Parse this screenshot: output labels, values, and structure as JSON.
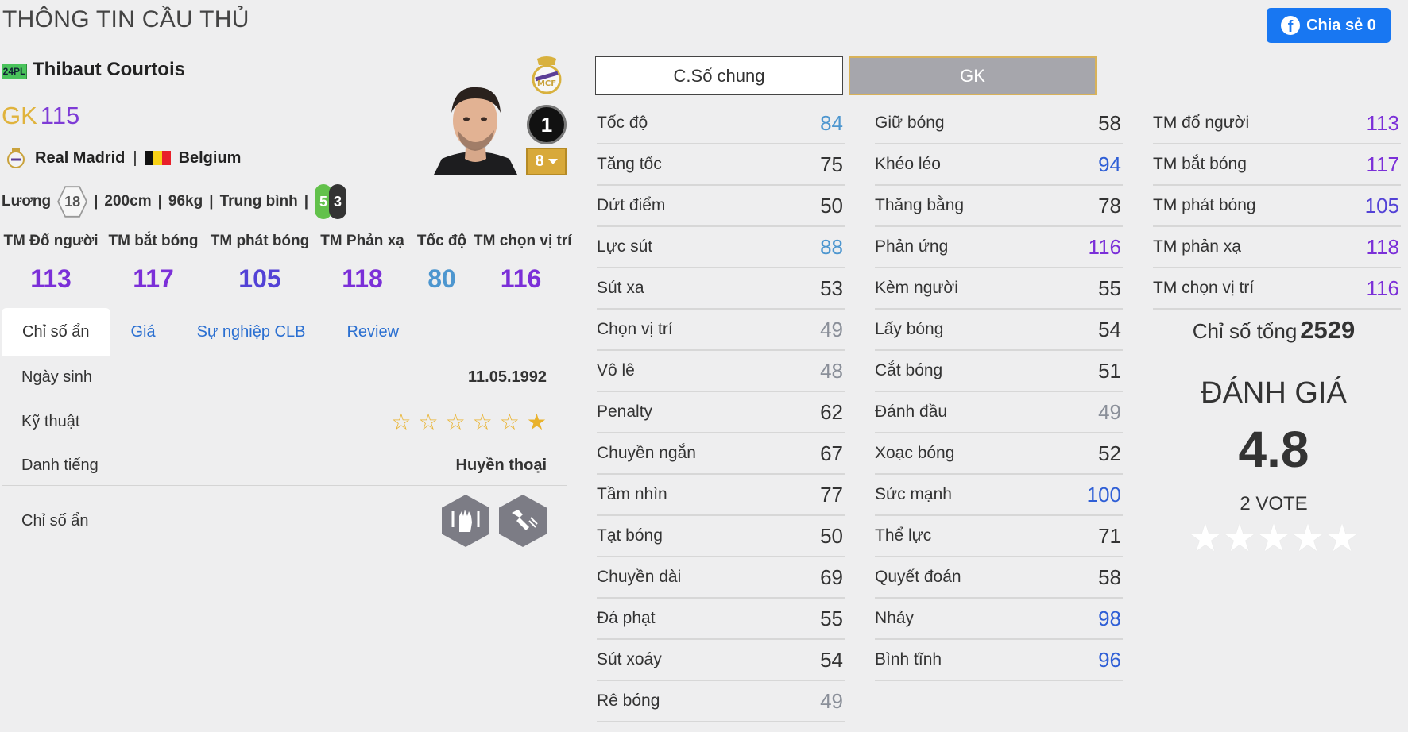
{
  "header": {
    "title": "THÔNG TIN CẦU THỦ",
    "share_label": "Chia sẻ 0"
  },
  "player": {
    "season": "24PL",
    "name": "Thibaut Courtois",
    "position": "GK",
    "ovr": "115",
    "club": "Real Madrid",
    "nation": "Belgium",
    "salary_label": "Lương",
    "salary": "18",
    "height": "200cm",
    "weight": "96kg",
    "body_type": "Trung bình",
    "left_foot": "5",
    "right_foot": "3",
    "rank": "1",
    "upgrade": "8"
  },
  "key_stats": [
    {
      "label": "TM Đổ người",
      "value": "113",
      "color": "#7b2fd8"
    },
    {
      "label": "TM bắt bóng",
      "value": "117",
      "color": "#7b2fd8"
    },
    {
      "label": "TM phát bóng",
      "value": "105",
      "color": "#5342d6"
    },
    {
      "label": "TM Phản xạ",
      "value": "118",
      "color": "#7b2fd8"
    },
    {
      "label": "Tốc độ",
      "value": "80",
      "color": "#4d96cf"
    },
    {
      "label": "TM chọn vị trí",
      "value": "116",
      "color": "#7b2fd8"
    }
  ],
  "tabs": [
    "Chỉ số ẩn",
    "Giá",
    "Sự nghiệp CLB",
    "Review"
  ],
  "info": {
    "birth_label": "Ngày sinh",
    "birth": "11.05.1992",
    "skill_label": "Kỹ thuật",
    "skill_stars": 1,
    "fame_label": "Danh tiếng",
    "fame": "Huyền thoại",
    "hidden_label": "Chỉ số ẩn"
  },
  "stat_tabs": {
    "general": "C.Số chung",
    "gk": "GK"
  },
  "stats_col1": [
    {
      "name": "Tốc độ",
      "value": "84",
      "color": "#4d96cf"
    },
    {
      "name": "Tăng tốc",
      "value": "75",
      "color": "#333333"
    },
    {
      "name": "Dứt điểm",
      "value": "50",
      "color": "#333333"
    },
    {
      "name": "Lực sút",
      "value": "88",
      "color": "#4d96cf"
    },
    {
      "name": "Sút xa",
      "value": "53",
      "color": "#333333"
    },
    {
      "name": "Chọn vị trí",
      "value": "49",
      "color": "#8a8f99"
    },
    {
      "name": "Vô lê",
      "value": "48",
      "color": "#8a8f99"
    },
    {
      "name": "Penalty",
      "value": "62",
      "color": "#333333"
    },
    {
      "name": "Chuyền ngắn",
      "value": "67",
      "color": "#333333"
    },
    {
      "name": "Tầm nhìn",
      "value": "77",
      "color": "#333333"
    },
    {
      "name": "Tạt bóng",
      "value": "50",
      "color": "#333333"
    },
    {
      "name": "Chuyền dài",
      "value": "69",
      "color": "#333333"
    },
    {
      "name": "Đá phạt",
      "value": "55",
      "color": "#333333"
    },
    {
      "name": "Sút xoáy",
      "value": "54",
      "color": "#333333"
    },
    {
      "name": "Rê bóng",
      "value": "49",
      "color": "#8a8f99"
    }
  ],
  "stats_col2": [
    {
      "name": "Giữ bóng",
      "value": "58",
      "color": "#333333"
    },
    {
      "name": "Khéo léo",
      "value": "94",
      "color": "#2f5fd6"
    },
    {
      "name": "Thăng bằng",
      "value": "78",
      "color": "#333333"
    },
    {
      "name": "Phản ứng",
      "value": "116",
      "color": "#7b2fd8"
    },
    {
      "name": "Kèm người",
      "value": "55",
      "color": "#333333"
    },
    {
      "name": "Lấy bóng",
      "value": "54",
      "color": "#333333"
    },
    {
      "name": "Cắt bóng",
      "value": "51",
      "color": "#333333"
    },
    {
      "name": "Đánh đầu",
      "value": "49",
      "color": "#8a8f99"
    },
    {
      "name": "Xoạc bóng",
      "value": "52",
      "color": "#333333"
    },
    {
      "name": "Sức mạnh",
      "value": "100",
      "color": "#2f5fd6"
    },
    {
      "name": "Thể lực",
      "value": "71",
      "color": "#333333"
    },
    {
      "name": "Quyết đoán",
      "value": "58",
      "color": "#333333"
    },
    {
      "name": "Nhảy",
      "value": "98",
      "color": "#2f5fd6"
    },
    {
      "name": "Bình tĩnh",
      "value": "96",
      "color": "#2f5fd6"
    }
  ],
  "stats_col3": [
    {
      "name": "TM đổ người",
      "value": "113",
      "color": "#7b2fd8"
    },
    {
      "name": "TM bắt bóng",
      "value": "117",
      "color": "#7b2fd8"
    },
    {
      "name": "TM phát bóng",
      "value": "105",
      "color": "#5342d6"
    },
    {
      "name": "TM phản xạ",
      "value": "118",
      "color": "#7b2fd8"
    },
    {
      "name": "TM chọn vị trí",
      "value": "116",
      "color": "#7b2fd8"
    }
  ],
  "summary": {
    "total_label": "Chỉ số tổng",
    "total": "2529",
    "rating_title": "ĐÁNH GIÁ",
    "rating": "4.8",
    "votes": "2 VOTE"
  }
}
